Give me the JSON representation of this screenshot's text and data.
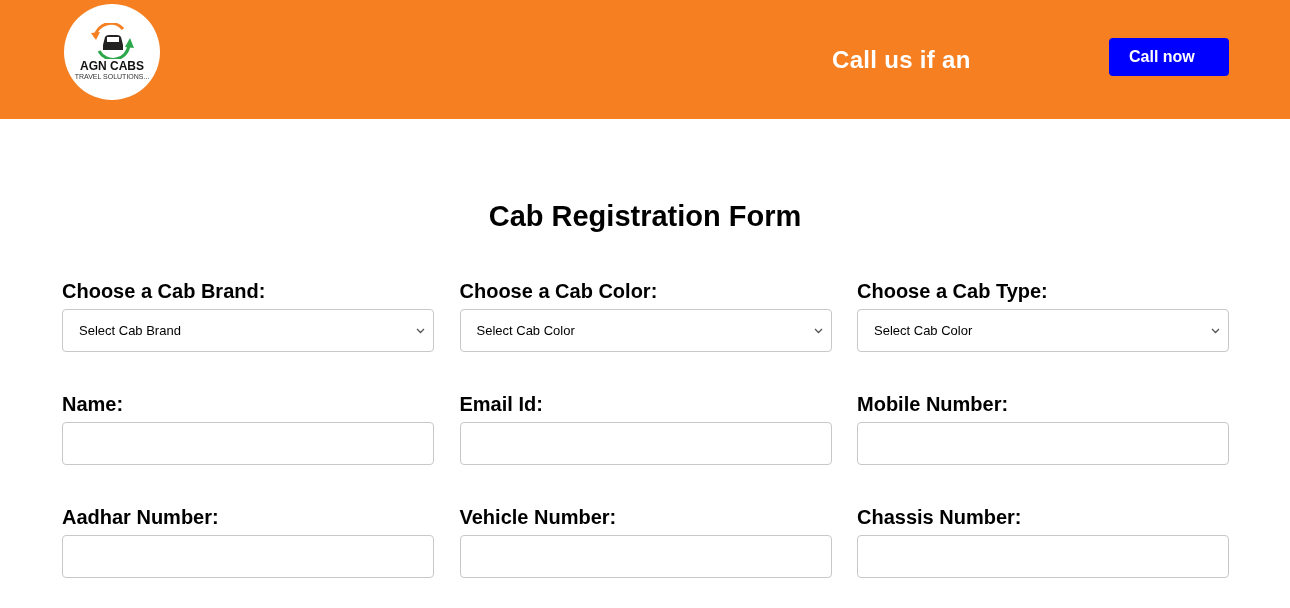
{
  "header": {
    "logo": {
      "name": "AGN CABS",
      "tagline": "TRAVEL SOLUTIONS..."
    },
    "marquee": "Call us if an",
    "call_button": "Call now"
  },
  "form": {
    "title": "Cab Registration Form",
    "fields": [
      {
        "kind": "select",
        "label": "Choose a Cab Brand:",
        "value": "Select Cab Brand"
      },
      {
        "kind": "select",
        "label": "Choose a Cab Color:",
        "value": "Select Cab Color"
      },
      {
        "kind": "select",
        "label": "Choose a Cab Type:",
        "value": "Select Cab Color"
      },
      {
        "kind": "input",
        "label": "Name:"
      },
      {
        "kind": "input",
        "label": "Email Id:"
      },
      {
        "kind": "input",
        "label": "Mobile Number:"
      },
      {
        "kind": "input",
        "label": "Aadhar Number:"
      },
      {
        "kind": "input",
        "label": "Vehicle Number:"
      },
      {
        "kind": "input",
        "label": "Chassis Number:"
      }
    ]
  }
}
